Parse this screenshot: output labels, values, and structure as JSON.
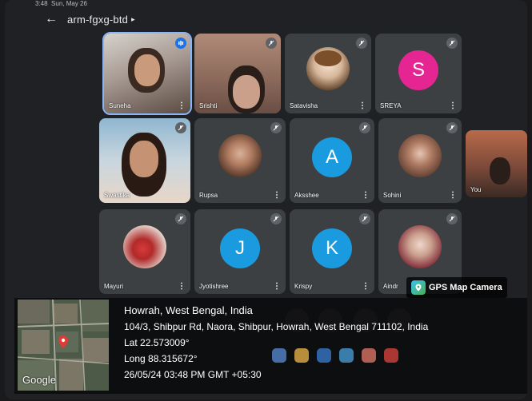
{
  "status_bar": {
    "time": "3:48",
    "date": "Sun, May 26"
  },
  "header": {
    "meeting_code": "arm-fgxg-btd"
  },
  "participants": [
    {
      "name": "Suneha"
    },
    {
      "name": "Srishti"
    },
    {
      "name": "Satavisha"
    },
    {
      "name": "SREYA",
      "initial": "S",
      "color": "#e52592"
    },
    {
      "name": "Swastika"
    },
    {
      "name": "Rupsa"
    },
    {
      "name": "Aksshee",
      "initial": "A",
      "color": "#1a9be0"
    },
    {
      "name": "Sohini"
    },
    {
      "name": "You"
    },
    {
      "name": "Mayuri"
    },
    {
      "name": "Jyotishree",
      "initial": "J",
      "color": "#1a9be0"
    },
    {
      "name": "Krispy",
      "initial": "K",
      "color": "#1a9be0"
    },
    {
      "name": "Aindr"
    }
  ],
  "gps": {
    "app_name": "GPS Map Camera",
    "map_label": "Google",
    "place": "Howrah, West Bengal, India",
    "address": "104/3, Shibpur Rd, Naora, Shibpur, Howrah, West Bengal 711102, India",
    "lat": "Lat 22.573009°",
    "long": "Long 88.315672°",
    "datetime": "26/05/24 03:48 PM GMT +05:30"
  },
  "icons": {
    "back": "back-arrow-icon",
    "mic_off": "mic-off-icon",
    "speaking": "speaking-icon",
    "more": "more-vert-icon",
    "pin": "location-pin-icon"
  },
  "colors": {
    "background": "#202124",
    "tile": "#3c4043",
    "avatar_pink": "#e52592",
    "avatar_blue": "#1a9be0",
    "speaking": "#1a73e8"
  }
}
